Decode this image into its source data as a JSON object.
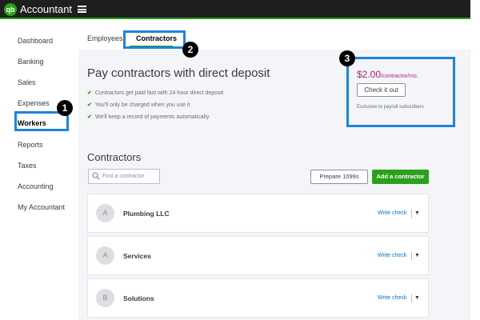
{
  "header": {
    "logo_text": "qb",
    "app_title": "Accountant",
    "brand_color": "#2ca01c"
  },
  "sidebar": {
    "items": [
      {
        "label": "Dashboard"
      },
      {
        "label": "Banking"
      },
      {
        "label": "Sales"
      },
      {
        "label": "Expenses"
      },
      {
        "label": "Workers",
        "active": true
      },
      {
        "label": "Reports"
      },
      {
        "label": "Taxes"
      },
      {
        "label": "Accounting"
      },
      {
        "label": "My Accountant"
      }
    ]
  },
  "tabs": [
    {
      "label": "Employees"
    },
    {
      "label": "Contractors",
      "active": true
    }
  ],
  "promo": {
    "title": "Pay contractors with direct deposit",
    "bullets": [
      "Contractors get paid fast with 24-hour direct deposit",
      "You'll only be charged when you use it",
      "We'll keep a record of payments automatically"
    ],
    "price": "$2.00",
    "price_unit": "/contractor/mo.",
    "check_button": "Check it out",
    "note": "Exclusive to payroll subscribers",
    "price_color": "#b0227f"
  },
  "contractors": {
    "title": "Contractors",
    "search_placeholder": "Find a contractor",
    "prepare_button": "Prepare 1099s",
    "add_button": "Add a contractor",
    "rows": [
      {
        "initial": "A",
        "name": "Plumbing LLC",
        "action": "Write check"
      },
      {
        "initial": "A",
        "name": "Services",
        "action": "Write check"
      },
      {
        "initial": "B",
        "name": "Solutions",
        "action": "Write check"
      }
    ]
  },
  "annotations": {
    "markers": [
      "1",
      "2",
      "3"
    ],
    "highlight_color": "#1f83d9"
  }
}
